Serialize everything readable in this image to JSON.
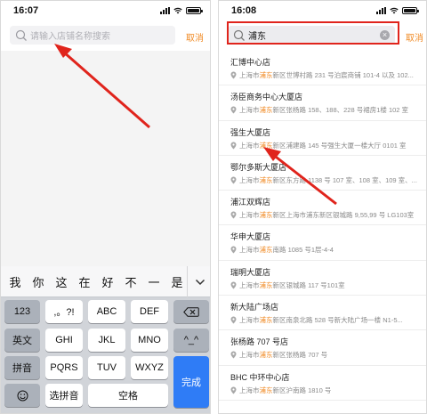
{
  "left_screen": {
    "time": "16:07",
    "search_placeholder": "请输入店铺名称搜索",
    "cancel_label": "取消",
    "candidates": [
      "我",
      "你",
      "这",
      "在",
      "好",
      "不",
      "一",
      "是"
    ],
    "keys": {
      "k123": "123",
      "punct": ",。?!",
      "abc": "ABC",
      "def": "DEF",
      "english": "英文",
      "ghi": "GHI",
      "jkl": "JKL",
      "mno": "MNO",
      "emoticon": "^_^",
      "pinyin": "拼音",
      "pqrs": "PQRS",
      "tuv": "TUV",
      "wxyz": "WXYZ",
      "done": "完成",
      "choose_pinyin": "选拼音",
      "space": "空格"
    }
  },
  "right_screen": {
    "time": "16:08",
    "search_query": "浦东",
    "cancel_label": "取消",
    "results": [
      {
        "name": "汇博中心店",
        "addr_before": "上海市",
        "addr_hl": "浦东",
        "addr_after": "新区世博村路 231 号泊宸商铺 101-4 以及 102..."
      },
      {
        "name": "汤臣商务中心大厦店",
        "addr_before": "上海市",
        "addr_hl": "浦东",
        "addr_after": "新区张杨路 158、188、228 号裙房1楼 102 室"
      },
      {
        "name": "强生大厦店",
        "addr_before": "上海市",
        "addr_hl": "浦东",
        "addr_after": "新区浦建路 145 号强生大厦一楼大厅 0101 室"
      },
      {
        "name": "鄂尔多斯大厦店",
        "addr_before": "上海市",
        "addr_hl": "浦东",
        "addr_after": "新区东方路 1138 号 107 室、108 室、109 室、..."
      },
      {
        "name": "浦江双辉店",
        "addr_before": "上海市",
        "addr_hl": "浦东",
        "addr_after": "新区上海市浦东新区银城路 9,55,99 号 LG103室"
      },
      {
        "name": "华申大厦店",
        "addr_before": "上海市",
        "addr_hl": "浦东",
        "addr_after": "南路 1085 号1层-4-4"
      },
      {
        "name": "瑞明大厦店",
        "addr_before": "上海市",
        "addr_hl": "浦东",
        "addr_after": "新区银城路 117 号101室"
      },
      {
        "name": "新大陆广场店",
        "addr_before": "上海市",
        "addr_hl": "浦东",
        "addr_after": "新区南泉北路 528 号新大陆广场一楼 N1-5..."
      },
      {
        "name": "张杨路 707 号店",
        "addr_before": "上海市",
        "addr_hl": "浦东",
        "addr_after": "新区张杨路 707 号"
      },
      {
        "name": "BHC 中环中心店",
        "addr_before": "上海市",
        "addr_hl": "浦东",
        "addr_after": "新区沪南路 1810 号"
      }
    ]
  },
  "colors": {
    "accent_orange": "#f08a24",
    "annotation_red": "#e0241c",
    "keyboard_done_blue": "#2f7cf6"
  }
}
